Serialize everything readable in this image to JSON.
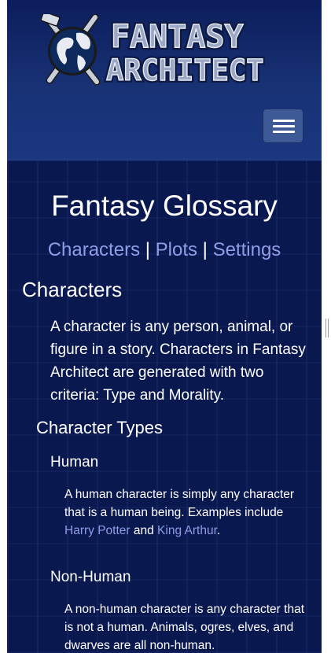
{
  "header": {
    "logo_line1": "FANTASY",
    "logo_line2": "ARCHITECT",
    "menu_icon": "hamburger-menu-icon"
  },
  "page": {
    "title": "Fantasy Glossary",
    "nav": {
      "characters": "Characters",
      "separator1": " | ",
      "plots": "Plots",
      "separator2": " | ",
      "settings": "Settings"
    }
  },
  "sections": {
    "characters": {
      "heading": "Characters",
      "intro": "A character is any person, animal, or figure in a story. Characters in Fantasy Architect are generated with two criteria: Type and Morality."
    },
    "character_types": {
      "heading": "Character Types",
      "human": {
        "heading": "Human",
        "text_before": "A human character is simply any character that is a human being. Examples include ",
        "link1": "Harry Potter",
        "text_mid": " and ",
        "link2": "King Arthur",
        "text_after": "."
      },
      "non_human": {
        "heading": "Non-Human",
        "text": "A non-human character is any character that is not a human. Animals, ogres, elves, and dwarves are all non-human."
      }
    }
  },
  "colors": {
    "background": "#0a1850",
    "header": "#183275",
    "link": "#8e9ee6",
    "menu_button": "#3d5a96"
  }
}
